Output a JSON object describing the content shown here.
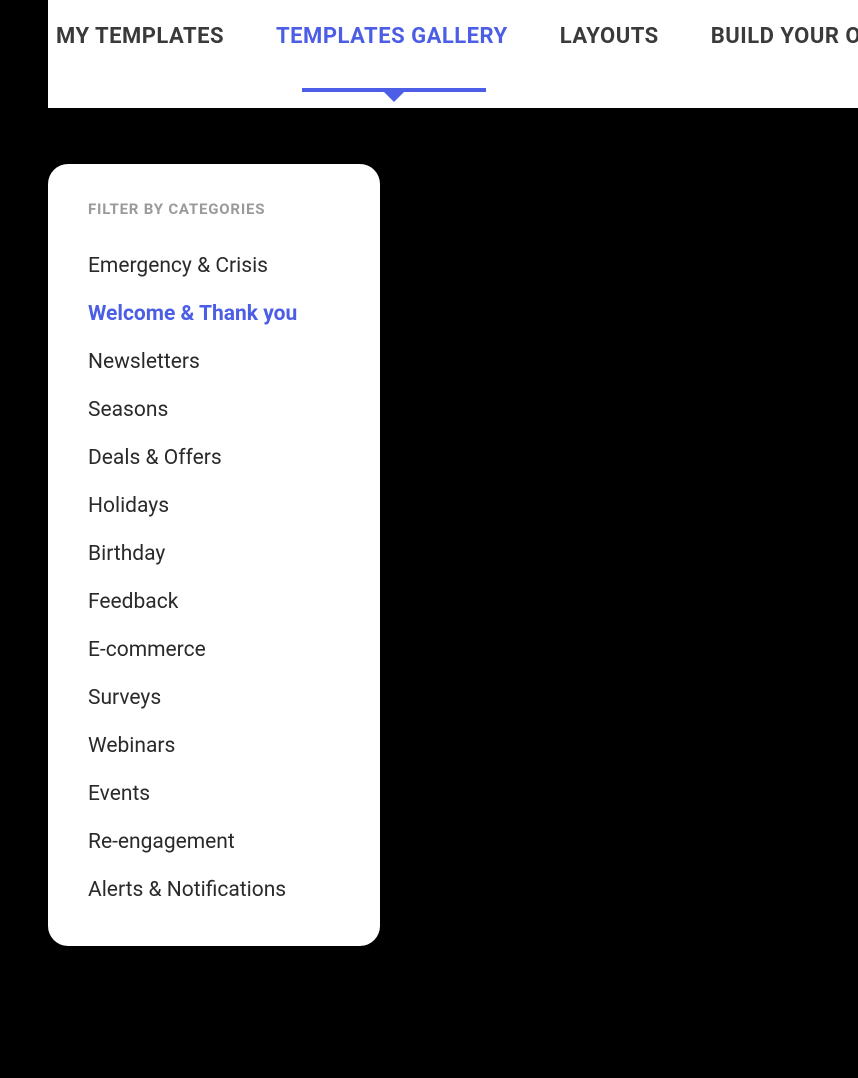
{
  "nav": {
    "items": [
      {
        "label": "MY TEMPLATES",
        "active": false
      },
      {
        "label": "TEMPLATES GALLERY",
        "active": true
      },
      {
        "label": "LAYOUTS",
        "active": false
      },
      {
        "label": "BUILD YOUR OWN",
        "active": false
      }
    ]
  },
  "filter": {
    "heading": "FILTER BY CATEGORIES",
    "categories": [
      {
        "label": "Emergency & Crisis",
        "active": false
      },
      {
        "label": "Welcome  & Thank you",
        "active": true
      },
      {
        "label": "Newsletters",
        "active": false
      },
      {
        "label": "Seasons",
        "active": false
      },
      {
        "label": "Deals & Offers",
        "active": false
      },
      {
        "label": "Holidays",
        "active": false
      },
      {
        "label": "Birthday",
        "active": false
      },
      {
        "label": "Feedback",
        "active": false
      },
      {
        "label": "E-commerce",
        "active": false
      },
      {
        "label": "Surveys",
        "active": false
      },
      {
        "label": "Webinars",
        "active": false
      },
      {
        "label": "Events",
        "active": false
      },
      {
        "label": "Re-engagement",
        "active": false
      },
      {
        "label": "Alerts & Notifications",
        "active": false
      }
    ]
  },
  "colors": {
    "accent": "#4b5ee5",
    "text_dark": "#3a3a3a",
    "text_muted": "#9a9a9a"
  }
}
